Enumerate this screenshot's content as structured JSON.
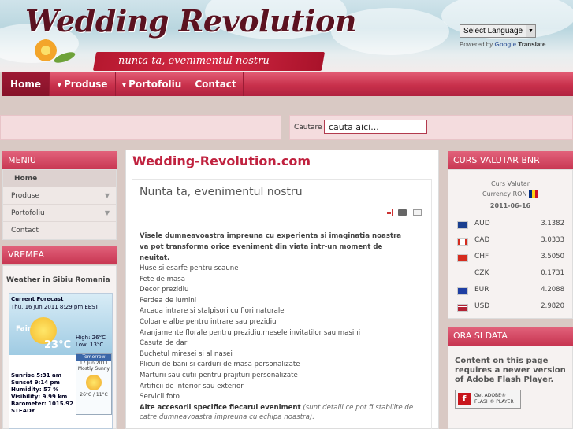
{
  "header": {
    "title": "Wedding Revolution",
    "tagline": "nunta ta, evenimentul nostru"
  },
  "translate": {
    "select_label": "Select Language",
    "powered_by": "Powered by",
    "google": "Google",
    "translate": "Translate"
  },
  "nav": {
    "items": [
      {
        "label": "Home"
      },
      {
        "label": "Produse"
      },
      {
        "label": "Portofoliu"
      },
      {
        "label": "Contact"
      }
    ]
  },
  "search": {
    "label": "Căutare",
    "value": "cauta aici..."
  },
  "sidebar": {
    "menu_title": "MENIU",
    "menu_items": [
      {
        "label": "Home"
      },
      {
        "label": "Produse"
      },
      {
        "label": "Portofoliu"
      },
      {
        "label": "Contact"
      }
    ],
    "weather_title": "VREMEA",
    "weather": {
      "location": "Weather in  Sibiu Romania",
      "current_forecast": "Current Forecast",
      "date": "Thu. 16 Jun 2011 8:29 pm EEST",
      "condition": "Fair",
      "temp": "23°C",
      "high": "High: 26°C",
      "low": "Low: 13°C",
      "sunrise": "Sunrise  5:31 am",
      "sunset": "Sunset 9:14 pm",
      "humidity": "Humidity:  57 %",
      "visibility": "Visibility:  9.99 km",
      "barometer": "Barometer: 1015.92 mb",
      "trend": "STEADY",
      "tomorrow_label": "Tomorrow",
      "tomorrow_date": "17 Jun 2011",
      "tomorrow_condition": "Mostly Sunny",
      "tomorrow_temps": "26°C / 11°C"
    }
  },
  "main": {
    "site_title": "Wedding-Revolution.com",
    "article_title": "Nunta ta, evenimentul nostru",
    "intro": "Visele dumneavoastra impreuna cu experienta si imaginatia noastra va pot transforma orice eveniment din viata intr-un moment de neuitat.",
    "items": [
      "Huse si esarfe pentru scaune",
      "Fete de masa",
      "Decor prezidiu",
      "Perdea de lumini",
      "Arcada intrare si stalpisori cu flori naturale",
      "Coloane albe pentru intrare sau prezidiu",
      "Aranjamente florale pentru prezidiu,mesele invitatilor sau masini",
      "Casuta de dar",
      "Buchetul miresei si al nasei",
      "Plicuri de bani si carduri de masa personalizate",
      "Marturii sau cutii pentru prajituri personalizate",
      "Artificii de interior sau exterior",
      "Servicii foto"
    ],
    "extra_bold": "Alte accesorii specifice fiecarui eveniment",
    "extra_note": "(sunt detalii ce pot fi stabilite de",
    "extra_note2": "catre dumneavoastra impreuna cu echipa noastra)."
  },
  "curs": {
    "title": "CURS VALUTAR BNR",
    "subtitle1": "Curs Valutar",
    "subtitle2": "Currency RON",
    "date": "2011-06-16",
    "rates": [
      {
        "code": "AUD",
        "value": "3.1382",
        "flag_color": "#1a3f8f"
      },
      {
        "code": "CAD",
        "value": "3.0333",
        "flag_color": "#d52b1e"
      },
      {
        "code": "CHF",
        "value": "3.5050",
        "flag_color": "#d52b1e"
      },
      {
        "code": "CZK",
        "value": "0.1731",
        "flag_color": ""
      },
      {
        "code": "EUR",
        "value": "4.2088",
        "flag_color": "#1f3fa3"
      },
      {
        "code": "USD",
        "value": "2.9820",
        "flag_color": "#b22234"
      }
    ]
  },
  "ora": {
    "title": "ORA SI DATA",
    "flash_text": "Content on this page requires a newer version of Adobe Flash Player.",
    "btn_line1": "Get ADOBE®",
    "btn_line2": "FLASH® PLAYER"
  }
}
